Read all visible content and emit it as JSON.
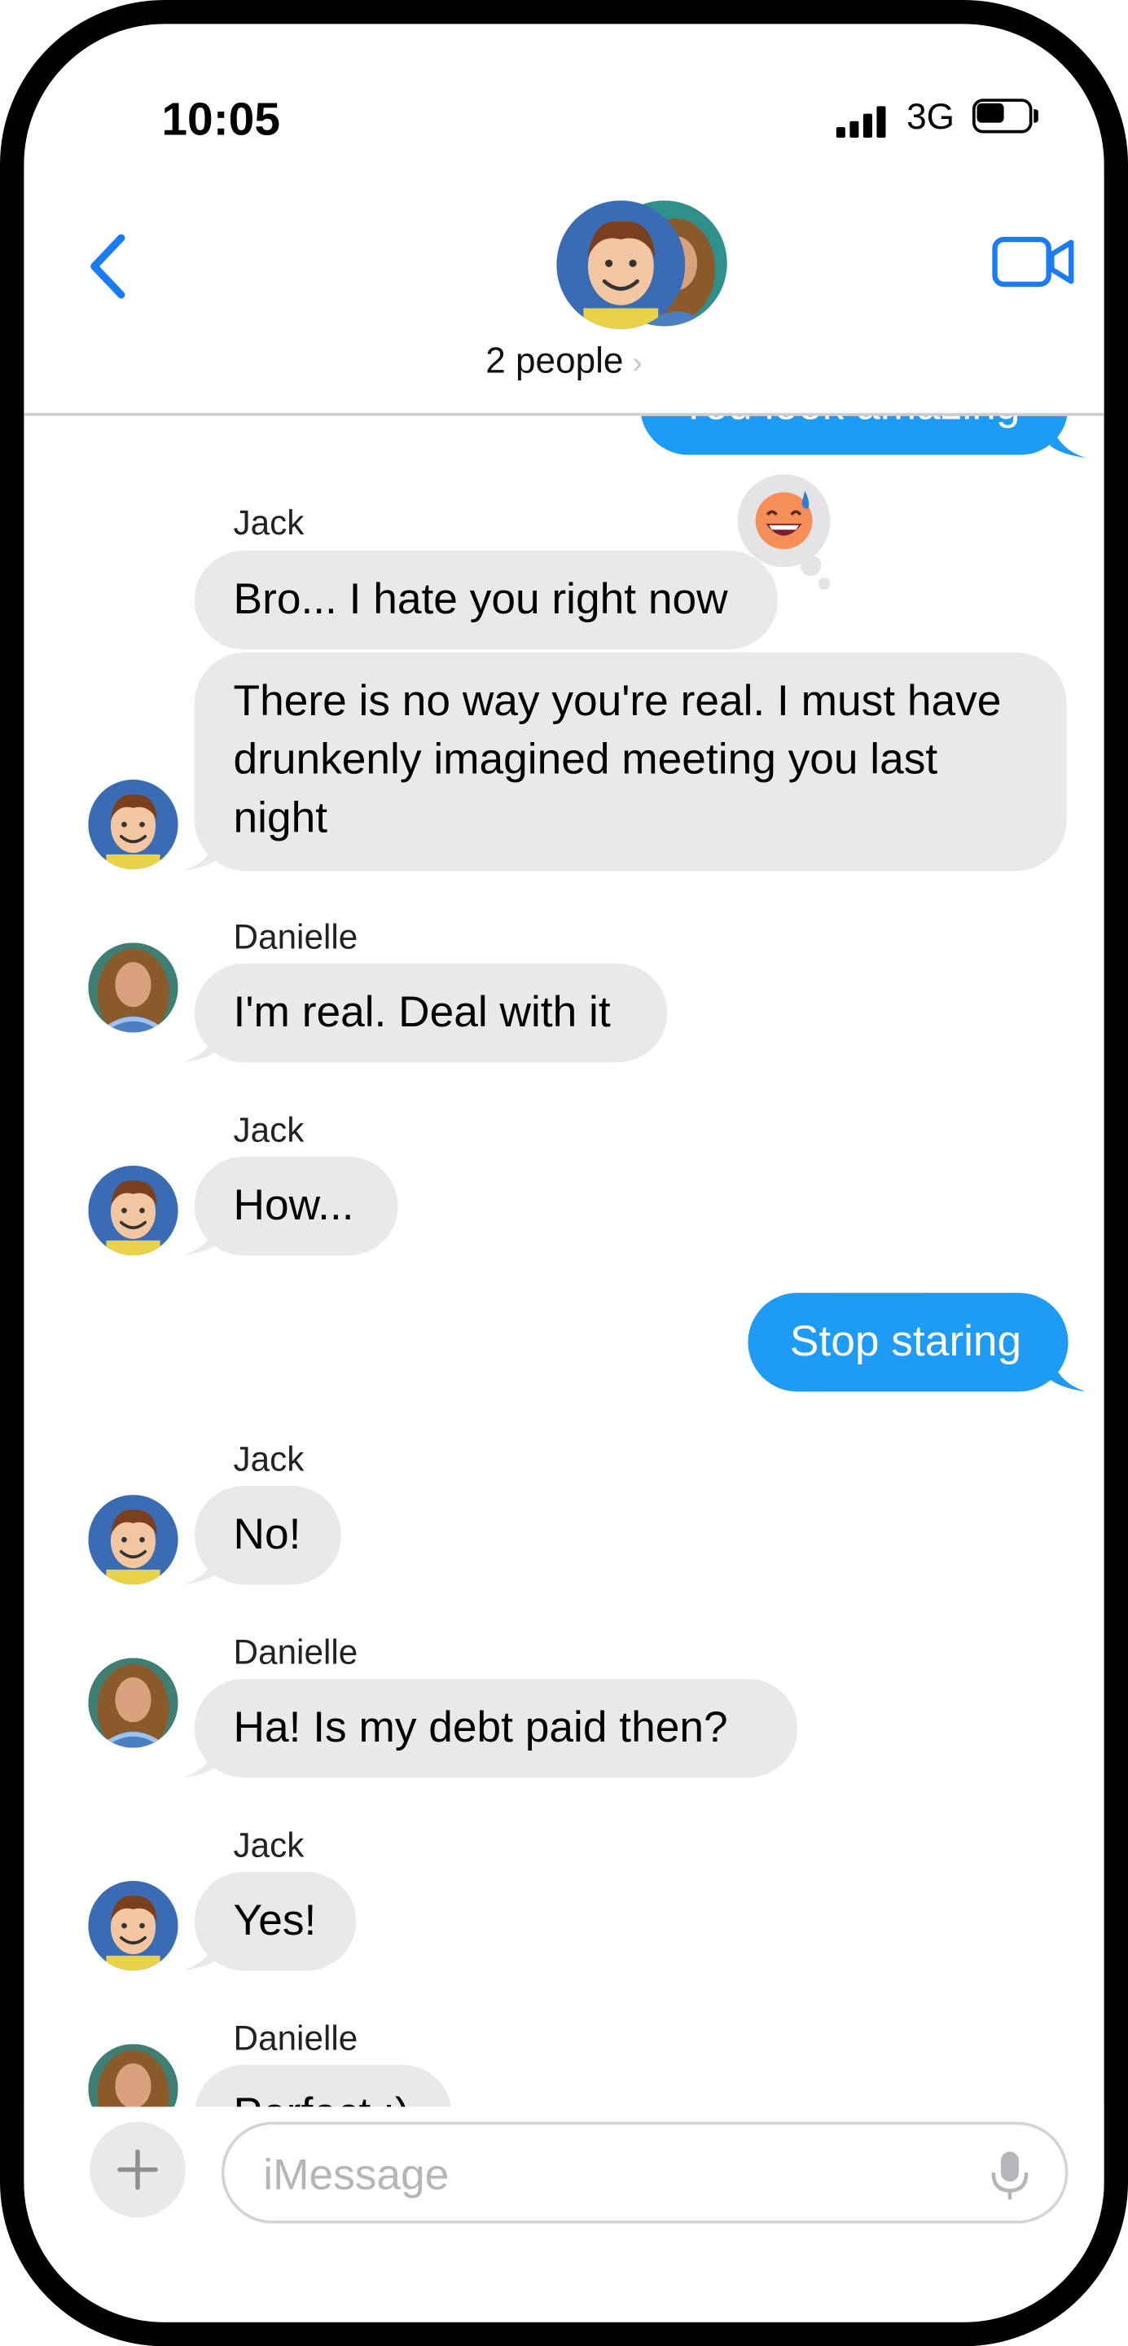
{
  "status_bar": {
    "time": "10:05",
    "network": "3G"
  },
  "header": {
    "participants_label": "2 people",
    "chevron": "›"
  },
  "colors": {
    "accent": "#1e9bf5",
    "incoming_bubble": "#e9e9eb",
    "nav_blue": "#1a7cf5"
  },
  "messages": [
    {
      "direction": "out",
      "text": "You look amazing"
    },
    {
      "direction": "in",
      "sender": "Jack",
      "text": "Bro... I hate you right now",
      "reaction": "grinning-sweat-emoji"
    },
    {
      "direction": "in",
      "text_lines": [
        "There is no way you're real.  I must have",
        "drunkenly imagined meeting you last",
        "night"
      ]
    },
    {
      "direction": "in",
      "sender": "Danielle",
      "text": "I'm real.  Deal with it"
    },
    {
      "direction": "in",
      "sender": "Jack",
      "text": "How..."
    },
    {
      "direction": "out",
      "text": "Stop staring"
    },
    {
      "direction": "in",
      "sender": "Jack",
      "text": "No!"
    },
    {
      "direction": "in",
      "sender": "Danielle",
      "text": "Ha!  Is my debt paid then?"
    },
    {
      "direction": "in",
      "sender": "Jack",
      "text": "Yes!"
    },
    {
      "direction": "in",
      "sender": "Danielle",
      "text": "Perfect :)"
    }
  ],
  "composer": {
    "placeholder": "iMessage"
  }
}
